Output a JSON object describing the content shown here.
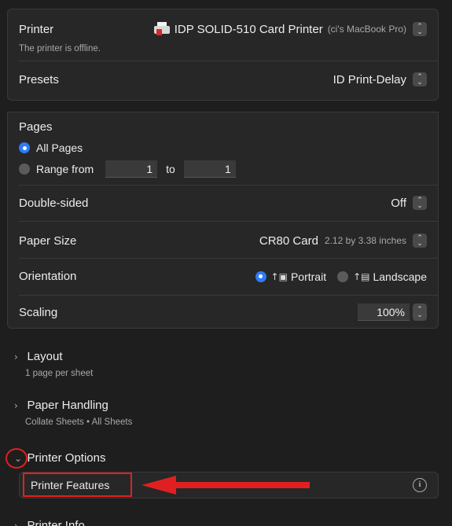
{
  "printer": {
    "label": "Printer",
    "name": "IDP SOLID-510 Card Printer",
    "host": "(ci's MacBook Pro)",
    "status": "The printer is offline."
  },
  "presets": {
    "label": "Presets",
    "value": "ID Print-Delay"
  },
  "pages": {
    "label": "Pages",
    "all_label": "All Pages",
    "range_label": "Range from",
    "range_from": "1",
    "range_to_label": "to",
    "range_to": "1"
  },
  "double_sided": {
    "label": "Double-sided",
    "value": "Off"
  },
  "paper_size": {
    "label": "Paper Size",
    "value": "CR80 Card",
    "detail": "2.12 by 3.38 inches"
  },
  "orientation": {
    "label": "Orientation",
    "portrait": "Portrait",
    "landscape": "Landscape"
  },
  "scaling": {
    "label": "Scaling",
    "value": "100%"
  },
  "sections": {
    "layout": {
      "title": "Layout",
      "subtitle": "1 page per sheet"
    },
    "paper_handling": {
      "title": "Paper Handling",
      "subtitle": "Collate Sheets • All Sheets"
    },
    "printer_options": {
      "title": "Printer Options",
      "item": "Printer Features"
    },
    "printer_info": {
      "title": "Printer Info"
    }
  },
  "colors": {
    "accent": "#2f7bf6",
    "annotation": "#e02020"
  }
}
